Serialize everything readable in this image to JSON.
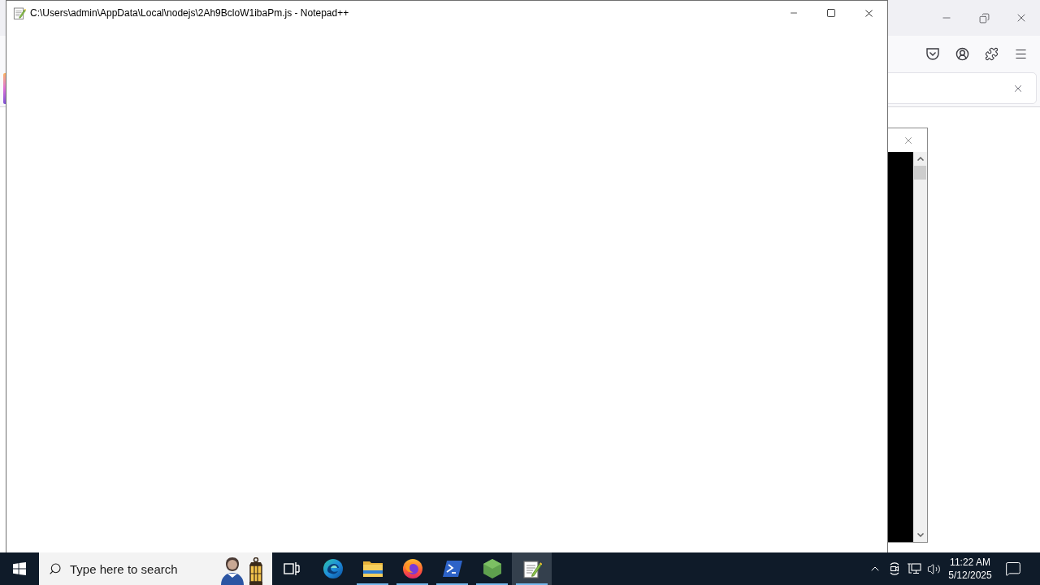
{
  "notepad_window": {
    "title": "C:\\Users\\admin\\AppData\\Local\\nodejs\\2Ah9BcloW1ibaPm.js - Notepad++"
  },
  "taskbar": {
    "search": {
      "placeholder": "Type here to search"
    },
    "apps": [
      {
        "kind": "swirl",
        "running": false,
        "selected": false
      },
      {
        "kind": "folder",
        "running": true,
        "selected": false
      },
      {
        "kind": "fox",
        "running": true,
        "selected": false
      },
      {
        "kind": "shell",
        "running": true,
        "selected": false
      },
      {
        "kind": "hexagon",
        "running": true,
        "selected": false
      },
      {
        "kind": "notepad",
        "running": true,
        "selected": true
      }
    ],
    "clock": {
      "time": "11:22 AM",
      "date": "5/12/2025"
    }
  }
}
